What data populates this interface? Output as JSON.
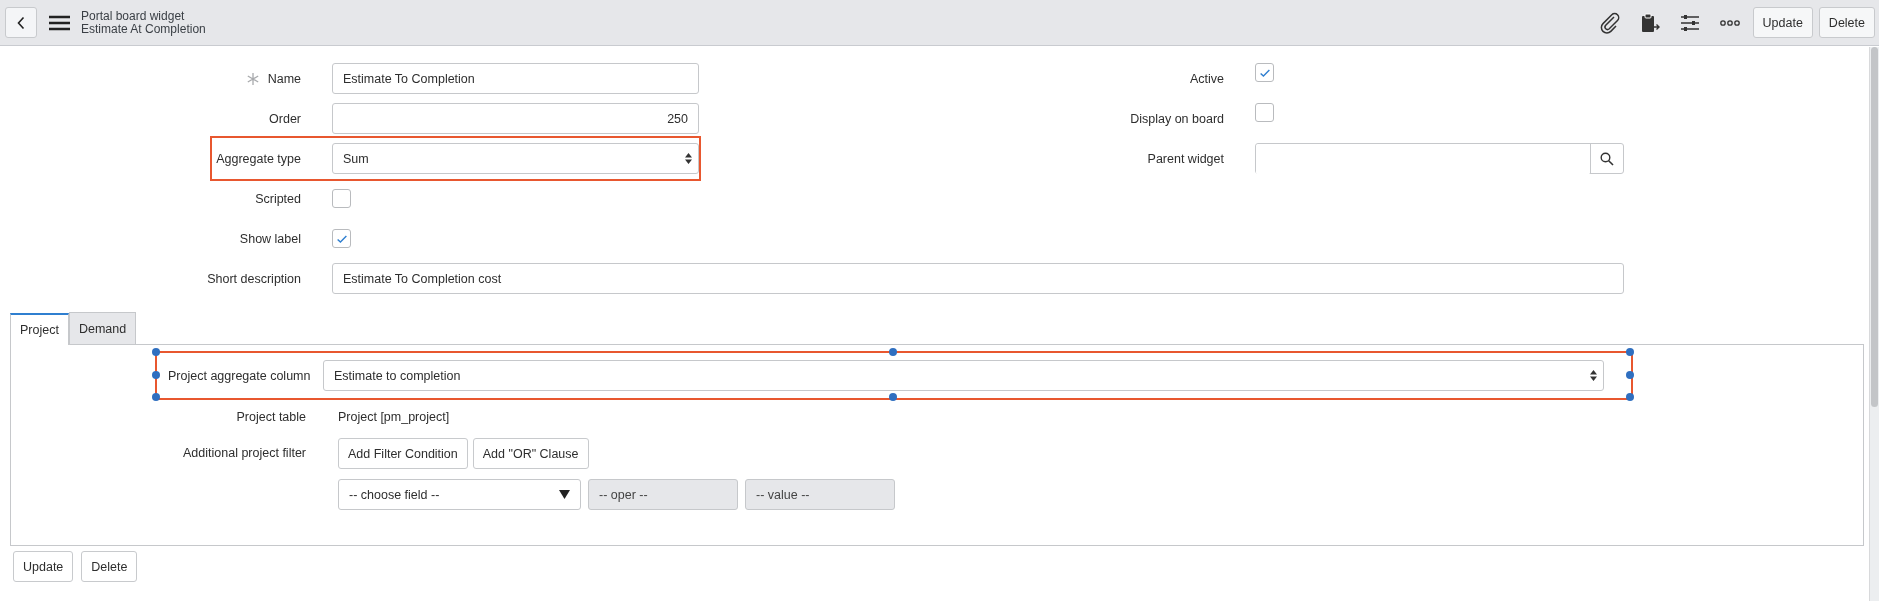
{
  "header": {
    "subtitle": "Portal board widget",
    "title": "Estimate At Completion",
    "buttons": [
      "Update",
      "Delete"
    ]
  },
  "left_fields": [
    {
      "kind": "text",
      "label": "Name",
      "required": true,
      "value": "Estimate To Completion",
      "highlighted": false
    },
    {
      "kind": "number",
      "label": "Order",
      "required": false,
      "value": "250",
      "highlighted": false
    },
    {
      "kind": "select",
      "label": "Aggregate type",
      "required": false,
      "value": "Sum",
      "highlighted": true
    },
    {
      "kind": "checkbox",
      "label": "Scripted",
      "required": false,
      "checked": false,
      "highlighted": false
    },
    {
      "kind": "checkbox",
      "label": "Show label",
      "required": false,
      "checked": true,
      "highlighted": false
    }
  ],
  "right_fields": [
    {
      "kind": "checkbox",
      "label": "Active",
      "checked": true
    },
    {
      "kind": "checkbox",
      "label": "Display on board",
      "checked": false
    },
    {
      "kind": "reference",
      "label": "Parent widget"
    }
  ],
  "short_description": {
    "label": "Short description",
    "value": "Estimate To Completion cost"
  },
  "tabs": [
    {
      "label": "Project",
      "selected": true
    },
    {
      "label": "Demand",
      "selected": false
    }
  ],
  "tab_panel": {
    "aggregate_column": {
      "label": "Project aggregate column",
      "value": "Estimate to completion"
    },
    "project_table": {
      "label": "Project table",
      "value": "Project [pm_project]"
    },
    "filter": {
      "label": "Additional project filter",
      "buttons": [
        "Add Filter Condition",
        "Add \"OR\" Clause"
      ],
      "selects": [
        {
          "kind": "dropdown",
          "value": "-- choose field --",
          "disabled": false
        },
        {
          "kind": "plain",
          "value": "-- oper --",
          "disabled": true
        },
        {
          "kind": "plain",
          "value": "-- value --",
          "disabled": true
        }
      ]
    }
  },
  "footer_buttons": [
    "Update",
    "Delete"
  ]
}
